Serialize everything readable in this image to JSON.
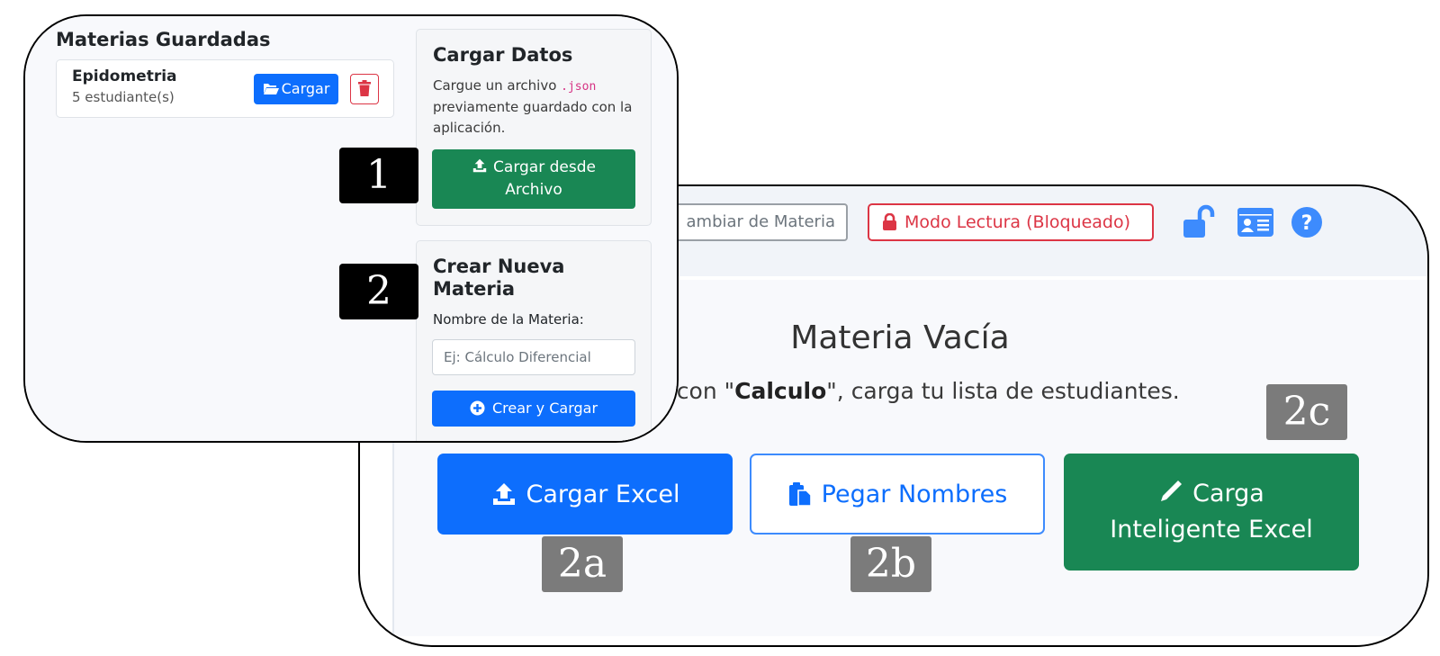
{
  "back_panel": {
    "topbar": {
      "change_subject_label": "ambiar de Materia",
      "read_mode_label": "Modo Lectura (Bloqueado)",
      "icons": [
        "lock-open-icon",
        "id-card-icon",
        "question-circle-icon"
      ]
    },
    "empty_state": {
      "title": "Materia Vacía",
      "message_prefix": "nzar con \"",
      "subject": "Calculo",
      "message_suffix": "\", carga tu lista de estudiantes."
    },
    "buttons": {
      "excel": "Cargar Excel",
      "paste": "Pegar Nombres",
      "smart_line1": "Carga",
      "smart_line2": "Inteligente Excel"
    }
  },
  "front_panel": {
    "saved": {
      "title": "Materias Guardadas",
      "items": [
        {
          "name": "Epidometria",
          "count": "5 estudiante(s)",
          "load_label": "Cargar"
        }
      ]
    },
    "load_card": {
      "title": "Cargar Datos",
      "desc_before": "Cargue un archivo ",
      "desc_code": ".json",
      "desc_after": " previamente guardado con la aplicación.",
      "button_line1": "Cargar desde",
      "button_line2": "Archivo"
    },
    "create_card": {
      "title": "Crear Nueva Materia",
      "label": "Nombre de la Materia:",
      "placeholder": "Ej: Cálculo Diferencial",
      "button": "Crear y Cargar"
    }
  },
  "annotations": {
    "tag_1": "1",
    "tag_2": "2",
    "tag_2a": "2a",
    "tag_2b": "2b",
    "tag_2c": "2c"
  },
  "colors": {
    "primary": "#0d6efd",
    "success": "#198754",
    "danger": "#dc3545",
    "secondary": "#6c757d",
    "icon_blue": "#3d8bfd",
    "tag_gray": "#7b7b7b",
    "tag_black": "#000000"
  }
}
